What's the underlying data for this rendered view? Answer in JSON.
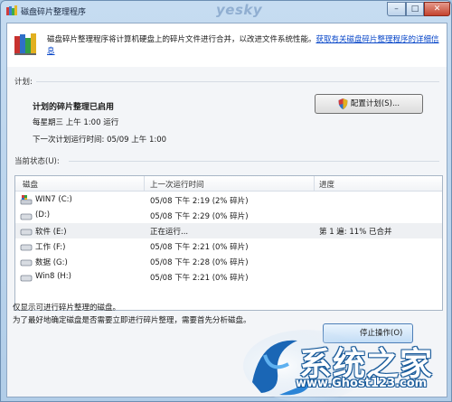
{
  "window": {
    "title": "磁盘碎片整理程序",
    "watermark": "yesky",
    "controls": {
      "minimize": "–",
      "maximize": "□",
      "close": "✕"
    }
  },
  "header": {
    "description": "磁盘碎片整理程序将计算机硬盘上的碎片文件进行合并，以改进文件系统性能。",
    "link": "获取有关磁盘碎片整理程序的详细信息"
  },
  "schedule": {
    "section_label": "计划:",
    "status": "计划的碎片整理已启用",
    "frequency": "每星期三 上午 1:00 运行",
    "next_run": "下一次计划运行时间: 05/09 上午 1:00",
    "configure_button": "配置计划(S)..."
  },
  "current_status": {
    "section_label": "当前状态(U):",
    "columns": [
      "磁盘",
      "上一次运行时间",
      "进度"
    ],
    "rows": [
      {
        "disk": "WIN7 (C:)",
        "last_run": "05/08 下午 2:19 (2% 碎片)",
        "progress": "",
        "icon": "system-drive-icon"
      },
      {
        "disk": "(D:)",
        "last_run": "05/08 下午 2:29 (0% 碎片)",
        "progress": "",
        "icon": "drive-icon"
      },
      {
        "disk": "软件 (E:)",
        "last_run": "正在运行...",
        "progress": "第 1 遍: 11% 已合并",
        "icon": "drive-icon"
      },
      {
        "disk": "工作 (F:)",
        "last_run": "05/08 下午 2:21 (0% 碎片)",
        "progress": "",
        "icon": "drive-icon"
      },
      {
        "disk": "数据 (G:)",
        "last_run": "05/08 下午 2:28 (0% 碎片)",
        "progress": "",
        "icon": "drive-icon"
      },
      {
        "disk": "Win8 (H:)",
        "last_run": "05/08 下午 2:21 (0% 碎片)",
        "progress": "",
        "icon": "drive-icon"
      }
    ]
  },
  "footer": {
    "note1": "仅显示可进行碎片整理的磁盘。",
    "note2": "为了最好地确定磁盘是否需要立即进行碎片整理，需要首先分析磁盘。",
    "stop_button": "停止操作(O)"
  },
  "site_logo": {
    "name": "系统之家",
    "url": "www.Ghost123.com"
  },
  "colors": {
    "link": "#0645c8",
    "title_bar": "#c6dcf1",
    "logo_blue": "#1a5b9a"
  }
}
